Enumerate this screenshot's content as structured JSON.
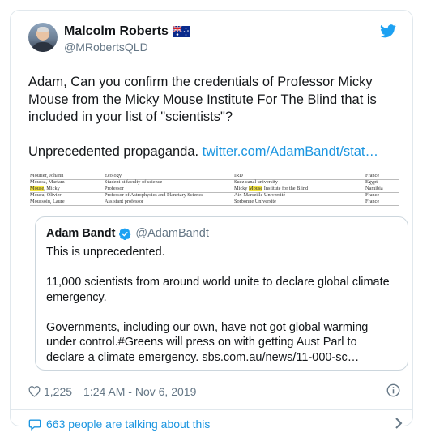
{
  "tweet": {
    "author_name": "Malcolm Roberts",
    "author_handle": "@MRobertsQLD",
    "text_main": "Adam, Can you confirm the credentials of Professor Micky Mouse from the Micky Mouse Institute For The Blind that is included in your list of \"scientists\"?",
    "text_tail": "Unprecedented propaganda. ",
    "link_text": "twitter.com/AdamBandt/stat…"
  },
  "embedded_list": {
    "rows": [
      {
        "name": "Mourier, Johann",
        "position": "Ecology",
        "institution": "IRD",
        "country": "France",
        "name_hl": ""
      },
      {
        "name": "Moussa, Mariam",
        "position": "Student at faculty of science",
        "institution": "Suez canal university",
        "country": "Egypt",
        "name_hl": ""
      },
      {
        "name": ", Micky",
        "position": "Professor",
        "institution": "Micky ",
        "institution_hl": "Mouse",
        "institution_tail": " Institute for the Blind",
        "country": "Namibia",
        "name_hl": "Mouse"
      },
      {
        "name": "Mousu, Olivier",
        "position": "Professor of Astrophysics and Planetary Science",
        "institution": "Aix-Marseille Université",
        "country": "France",
        "name_hl": ""
      },
      {
        "name": "Moussoiu, Laure",
        "position": "Assistant professor",
        "institution": "Sorbonne Université",
        "country": "France",
        "name_hl": ""
      }
    ]
  },
  "quoted_tweet": {
    "author_name": "Adam Bandt",
    "author_handle": "@AdamBandt",
    "text": "This is unprecedented.\n\n11,000 scientists from around world unite to declare global climate emergency.\n\nGovernments, including our own, have not got global warming under control.#Greens will press on with getting Aust Parl to declare a climate emergency. sbs.com.au/news/11-000-sc…"
  },
  "meta": {
    "likes": "1,225",
    "timestamp": "1:24 AM - Nov 6, 2019"
  },
  "conversation": {
    "label": "663 people are talking about this"
  },
  "icons": {
    "brand": "twitter-bird-icon",
    "like": "heart-icon",
    "info": "info-icon",
    "reply": "speech-bubble-icon",
    "chevron": "chevron-right-icon",
    "flag": "australian-flag-icon",
    "verified": "verified-badge-icon"
  },
  "colors": {
    "link": "#1b95e0",
    "secondary_text": "#657786",
    "border": "#e1e8ed",
    "highlight": "#f5e642"
  }
}
